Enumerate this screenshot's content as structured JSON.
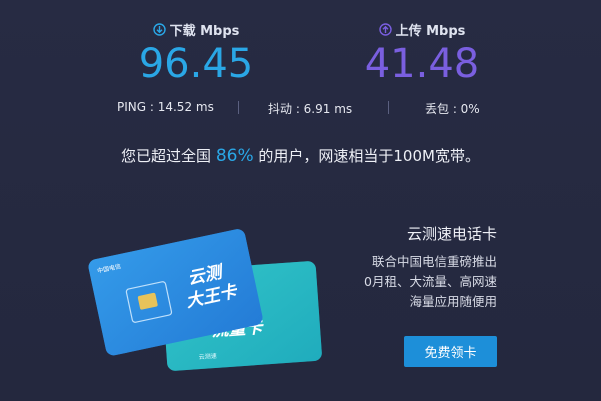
{
  "download": {
    "label": "下载 Mbps",
    "value": "96.45",
    "icon": "download-icon",
    "color": "#2aa7e6"
  },
  "upload": {
    "label": "上传 Mbps",
    "value": "41.48",
    "icon": "upload-icon",
    "color": "#7a5fe0"
  },
  "stats": {
    "ping": "PING : 14.52 ms",
    "jitter": "抖动 : 6.91 ms",
    "loss": "丢包 : 0%"
  },
  "summary": {
    "before": "您已超过全国 ",
    "percent": "86%",
    "after": " 的用户，网速相当于100M宽带。"
  },
  "promo": {
    "title": "云测速电话卡",
    "lines": [
      "联合中国电信重磅推出",
      "0月租、大流量、高网速",
      "海量应用随便用"
    ],
    "button": "免费领卡",
    "card_front_text": "云测 大王卡",
    "card_back_text": "云测 流量卡"
  }
}
